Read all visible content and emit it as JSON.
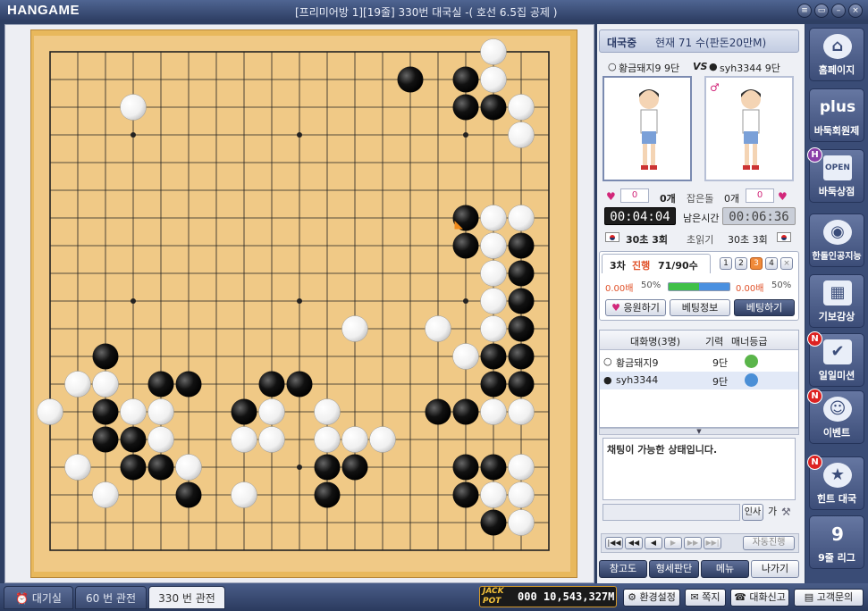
{
  "titlebar": {
    "logo": "HANGAME",
    "title": "[프리미어방 1][19줄] 330번 대국실 -( 호선 6.5집 공제 )"
  },
  "game": {
    "status": "대국중",
    "move_info": "현재 71 수(판돈20만M)",
    "white_player": "황금돼지9 9단",
    "vs": "VS",
    "black_player": "syh3344 9단",
    "captured_label": "잡은돌",
    "white_captured": "0개",
    "black_captured": "0개",
    "white_likes": "0",
    "black_likes": "0",
    "remaining_label": "남은시간",
    "white_time": "00:04:04",
    "black_time": "00:06:36",
    "byoyomi_label": "초읽기",
    "white_byoyomi": "30초 3회",
    "black_byoyomi": "30초 3회"
  },
  "betting": {
    "round": "3차",
    "progress_label": "진행",
    "moves": "71/90수",
    "round_buttons": [
      "1",
      "2",
      "3",
      "4"
    ],
    "left_odds": "0.00배",
    "left_pct": "50%",
    "right_odds": "0.00배",
    "right_pct": "50%",
    "bar_left_fraction": 0.5,
    "cheer_button": "응원하기",
    "info_button": "베팅정보",
    "bet_button": "베팅하기"
  },
  "chatlist": {
    "header_name": "대화명(3명)",
    "header_rank": "기력",
    "header_manner": "매너등급",
    "rows": [
      {
        "stone": "white",
        "name": "황금돼지9",
        "rank": "9단"
      },
      {
        "stone": "black",
        "name": "syh3344",
        "rank": "9단"
      }
    ]
  },
  "chat": {
    "message": "채팅이 가능한 상태입니다.",
    "greet_button": "인사",
    "font_button": "가"
  },
  "replay": {
    "auto_button": "자동진행"
  },
  "actions": {
    "reference": "참고도",
    "evaluate": "형세판단",
    "menu": "메뉴",
    "exit": "나가기"
  },
  "sidebar": [
    {
      "label": "홈페이지",
      "icon": "home-icon",
      "badge": ""
    },
    {
      "label": "바둑회원제",
      "icon": "plus-icon",
      "badge": ""
    },
    {
      "label": "바둑상점",
      "icon": "shop-icon",
      "badge": "H"
    },
    {
      "label": "한돌인공지능",
      "icon": "robot-icon",
      "badge": ""
    },
    {
      "label": "기보감상",
      "icon": "board-icon",
      "badge": ""
    },
    {
      "label": "일일미션",
      "icon": "calendar-icon",
      "badge": "N"
    },
    {
      "label": "이벤트",
      "icon": "tiger-icon",
      "badge": "N"
    },
    {
      "label": "힌트 대국",
      "icon": "star-icon",
      "badge": "N"
    },
    {
      "label": "9줄 리그",
      "icon": "laurel-icon",
      "badge": ""
    }
  ],
  "sidebar_icon_text": {
    "plus": "plus",
    "open": "OPEN",
    "nine": "9"
  },
  "bottom": {
    "tabs": [
      "대기실",
      "60 번 관전",
      "330 번 관전"
    ],
    "jackpot_label": "JACK POT",
    "jackpot_value": "000 10,543,327M",
    "buttons": [
      "환경설정",
      "쪽지",
      "대화신고",
      "고객문의"
    ]
  },
  "board": {
    "size": 19,
    "last_move": [
      15,
      6
    ],
    "black": [
      [
        13,
        1
      ],
      [
        15,
        1
      ],
      [
        15,
        2
      ],
      [
        16,
        2
      ],
      [
        15,
        6
      ],
      [
        15,
        7
      ],
      [
        16,
        7
      ],
      [
        17,
        7
      ],
      [
        17,
        8
      ],
      [
        17,
        9
      ],
      [
        17,
        10
      ],
      [
        17,
        11
      ],
      [
        16,
        11
      ],
      [
        17,
        12
      ],
      [
        16,
        12
      ],
      [
        2,
        11
      ],
      [
        2,
        12
      ],
      [
        2,
        13
      ],
      [
        2,
        14
      ],
      [
        3,
        14
      ],
      [
        3,
        15
      ],
      [
        4,
        12
      ],
      [
        5,
        12
      ],
      [
        4,
        15
      ],
      [
        8,
        12
      ],
      [
        9,
        12
      ],
      [
        7,
        13
      ],
      [
        14,
        13
      ],
      [
        15,
        13
      ],
      [
        10,
        15
      ],
      [
        11,
        15
      ],
      [
        5,
        16
      ],
      [
        15,
        15
      ],
      [
        16,
        15
      ],
      [
        10,
        16
      ],
      [
        15,
        16
      ],
      [
        16,
        17
      ]
    ],
    "white": [
      [
        16,
        0
      ],
      [
        16,
        1
      ],
      [
        17,
        2
      ],
      [
        17,
        3
      ],
      [
        3,
        2
      ],
      [
        16,
        6
      ],
      [
        17,
        6
      ],
      [
        16,
        7
      ],
      [
        16,
        8
      ],
      [
        16,
        9
      ],
      [
        16,
        10
      ],
      [
        11,
        10
      ],
      [
        14,
        10
      ],
      [
        15,
        11
      ],
      [
        2,
        12
      ],
      [
        1,
        12
      ],
      [
        0,
        13
      ],
      [
        3,
        13
      ],
      [
        4,
        13
      ],
      [
        4,
        14
      ],
      [
        8,
        13
      ],
      [
        7,
        14
      ],
      [
        8,
        14
      ],
      [
        10,
        13
      ],
      [
        10,
        14
      ],
      [
        11,
        14
      ],
      [
        12,
        14
      ],
      [
        16,
        13
      ],
      [
        17,
        13
      ],
      [
        1,
        15
      ],
      [
        5,
        15
      ],
      [
        17,
        15
      ],
      [
        16,
        16
      ],
      [
        2,
        16
      ],
      [
        7,
        16
      ],
      [
        17,
        16
      ],
      [
        17,
        17
      ]
    ]
  }
}
